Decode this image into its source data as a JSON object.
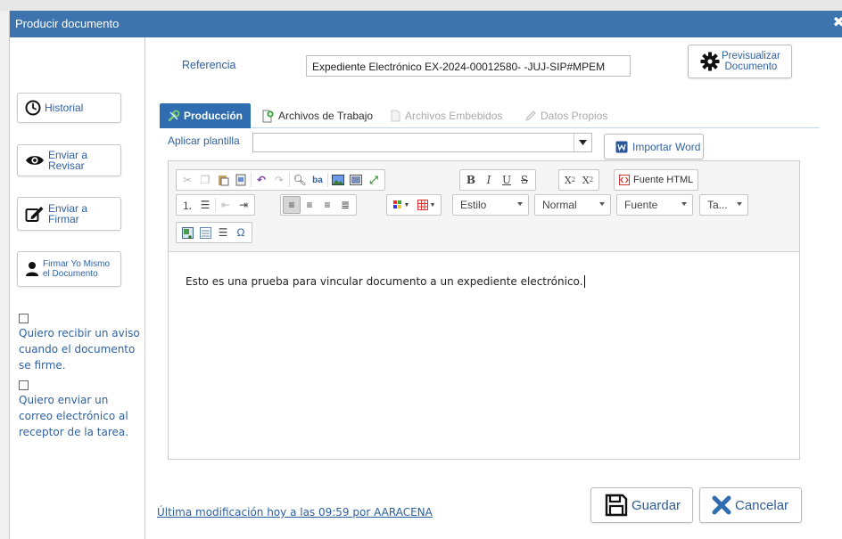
{
  "dialog": {
    "title": "Producir documento"
  },
  "sidebar": {
    "buttons": [
      {
        "label": "Historial",
        "icon": "clock-icon"
      },
      {
        "label": "Enviar a\nRevisar",
        "icon": "eye-icon"
      },
      {
        "label": "Enviar a\nFirmar",
        "icon": "sign-icon"
      },
      {
        "label": "Firmar Yo Mismo\nel Documento",
        "icon": "user-icon"
      }
    ],
    "checkboxes": [
      {
        "label": "Quiero recibir un aviso cuando el documento se firme.",
        "checked": false
      },
      {
        "label": "Quiero enviar un correo electrónico al receptor de la tarea.",
        "checked": false
      }
    ]
  },
  "reference": {
    "label": "Referencia",
    "value": "Expediente Electrónico EX-2024-00012580-  -JUJ-SIP#MPEM"
  },
  "preview_button": {
    "label": "Previsualizar\nDocumento"
  },
  "tabs": [
    {
      "label": "Producción",
      "active": true
    },
    {
      "label": "Archivos de Trabajo",
      "active": false
    },
    {
      "label": "Archivos Embebidos",
      "active": false,
      "disabled": true
    },
    {
      "label": "Datos Propios",
      "active": false,
      "disabled": true
    }
  ],
  "template": {
    "label": "Aplicar plantilla",
    "value": ""
  },
  "import_word": {
    "label": "Importar Word"
  },
  "editor": {
    "toolbar": {
      "bold": "B",
      "italic": "I",
      "underline": "U",
      "strike": "S",
      "subscript": "X",
      "superscript": "X",
      "source_label": "Fuente HTML",
      "style_label": "Estilo",
      "format_label": "Normal",
      "font_label": "Fuente",
      "size_label": "Ta...",
      "omega": "Ω"
    },
    "content": "Esto es una prueba para vincular documento a un expediente electrónico."
  },
  "footer": {
    "last_modified": "Última modificación hoy a las 09:59 por AARACENA",
    "save_label": "Guardar",
    "cancel_label": "Cancelar"
  },
  "colors": {
    "titlebar": "#3e74ad",
    "tab_active": "#2f6db0",
    "link": "#3061a2",
    "cancel_icon": "#2f6db0"
  }
}
